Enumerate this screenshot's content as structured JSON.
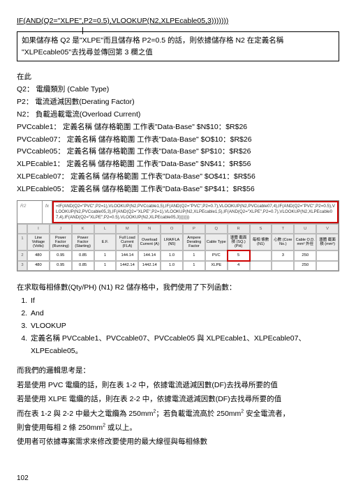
{
  "formula": "IF(AND(Q2=\"XLPE\",P2=0.5),VLOOKUP(N2,XLPEcable05,3)))))))",
  "callout": "如果儲存格 Q2 是\"XLPE\"而且儲存格 P2=0.5 的話，則依據儲存格 N2 在定義名稱  \"XLPEcable05\"去找尋並傳回第 3 欄之值",
  "defs": {
    "intro": "在此",
    "q2": "Q2：  電纜類別  (Cable Type)",
    "p2": "P2：  電流遞減因數(Derating Factor)",
    "n2": "N2：  負載過載電流(Overload Current)",
    "pvc1": "PVCcable1：  定義名稱  儲存格範圍  工作表\"Data-Base\" $N$10：$R$26",
    "pvc07": "PVCcable07：  定義名稱  儲存格範圍  工作表\"Data-Base\" $O$10：$R$26",
    "pvc05": "PVCcable05：  定義名稱  儲存格範圍  工作表\"Data-Base\" $P$10：$R$26",
    "xlpe1": "XLPEcable1：  定義名稱  儲存格範圍  工作表\"Data-Base\" $N$41：$R$56",
    "xlpe07": "XLPEcable07：  定義名稱  儲存格範圍  工作表\"Data-Base\" $O$41：$R$56",
    "xlpe05": "XLPEcable05：  定義名稱  儲存格範圍  工作表\"Data-Base\" $P$41：$R$56"
  },
  "sheet": {
    "name": "R2",
    "fx": "fx",
    "formula": "=IF(AND(Q2=\"PVC\",P2=1),VLOOKUP(N2,PVCcable1,5),IF(AND(Q2=\"PVC\",P2=0.7),VLOOKUP(N2,PVCcable07,4),IF(AND(Q2=\"PVC\",P2=0.5),VLOOKUP(N2,PVCcable05,3),IF(AND(Q2=\"XLPE\",P2=1),VLOOKUP(N2,XLPEcable1,5),IF(AND(Q2=\"XLPE\",P2=0.7),VLOOKUP(N2,XLPEcable07,4),IF(AND(Q2=\"XLPE\",P2=0.5),VLOOKUP(N2,XLPEcable05,3)))))))",
    "cols": [
      "",
      "I",
      "J",
      "K",
      "L",
      "M",
      "N",
      "O",
      "P",
      "Q",
      "R",
      "S",
      "T",
      "U",
      "V",
      "W"
    ],
    "headers": [
      "1",
      "Line Voltage (Volts)",
      "Power Factor (Running)",
      "Power Factor (Starting)",
      "E.F.",
      "Full Load Current (FLA)",
      "Overload Current (A)",
      "LRA/FLA (N5)",
      "Ampere Derating Factor",
      "Cable Type",
      "導體 截面積 (SQ.)(PH)",
      "每相 條數 (N1)",
      "心數 (Core No.)",
      "Cable O.D. mm² 外徑",
      "導體 截面積 (mm²)",
      ""
    ],
    "row2": [
      "2",
      "480",
      "0.95",
      "0.85",
      "1",
      "144.14",
      "144.14",
      "1.0",
      "1",
      "PVC",
      "5",
      "",
      "3",
      "250",
      "",
      ""
    ],
    "row3": [
      "3",
      "480",
      "0.95",
      "0.85",
      "1",
      "1442.14",
      "1442.14",
      "1.0",
      "1",
      "XLPE",
      "4",
      "",
      "",
      "250",
      "",
      ""
    ]
  },
  "aftersheet": "在求取每相條數(Qty/PH) (N1) R2 儲存格中，我們使用了下列函數：",
  "list": {
    "i1": "If",
    "i2": "And",
    "i3": "VLOOKUP",
    "i4": "定義名稱  PVCcable1、PVCcable07、PVCcable05 與 XLPEcable1、XLPEcable07、XLPEcable05。"
  },
  "body": {
    "p1": "而我們的邏輯思考是：",
    "p2": "若是使用 PVC 電纜的話，則在表 1-2 中，依據電流遞減因數(DF)去找尋所要的值",
    "p3": "若是使用 XLPE 電纜的話，則在表 2-2 中，依據電流遞減因數(DF)去找尋所要的值",
    "p4a": "而在表 1-2 與 2-2 中最大之電纜為 250mm",
    "p4b": "；若負載電流高於 250mm",
    "p4c": " 安全電流者，",
    "p5a": "則會使用每相 2 條 250mm",
    "p5b": " 或以上。",
    "p6": "使用者可依據專案需求來修改要使用的最大線徑與每相條數"
  },
  "page": "102"
}
